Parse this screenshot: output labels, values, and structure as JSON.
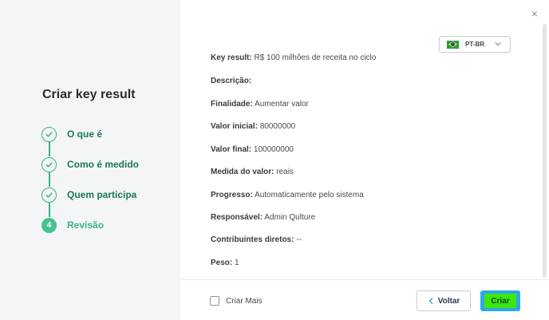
{
  "wizard": {
    "title": "Criar key result",
    "steps": [
      {
        "label": "O que é",
        "status": "done"
      },
      {
        "label": "Como é medido",
        "status": "done"
      },
      {
        "label": "Quem participa",
        "status": "done"
      },
      {
        "label": "Revisão",
        "status": "current",
        "number": "4"
      }
    ]
  },
  "close_icon": "×",
  "language": {
    "value": "PT-BR",
    "flag": "brazil-flag-icon"
  },
  "review": [
    {
      "label": "Key result:",
      "value": "R$ 100 milhões de receita no ciclo"
    },
    {
      "label": "Descrição:",
      "value": ""
    },
    {
      "label": "Finalidade:",
      "value": "Aumentar valor"
    },
    {
      "label": "Valor inicial:",
      "value": "80000000"
    },
    {
      "label": "Valor final:",
      "value": "100000000"
    },
    {
      "label": "Medida do valor:",
      "value": "reais"
    },
    {
      "label": "Progresso:",
      "value": "Automaticamente pelo sistema"
    },
    {
      "label": "Responsável:",
      "value": "Admin Qulture"
    },
    {
      "label": "Contribuintes diretos:",
      "value": "--"
    },
    {
      "label": "Peso:",
      "value": "1"
    }
  ],
  "footer": {
    "create_more_label": "Criar Mais",
    "create_more_checked": false,
    "back_label": "Voltar",
    "create_label": "Criar"
  },
  "colors": {
    "accent_green": "#36b37e",
    "create_button_bg": "#2ba9e8",
    "create_button_highlight": "#3ee60f"
  }
}
